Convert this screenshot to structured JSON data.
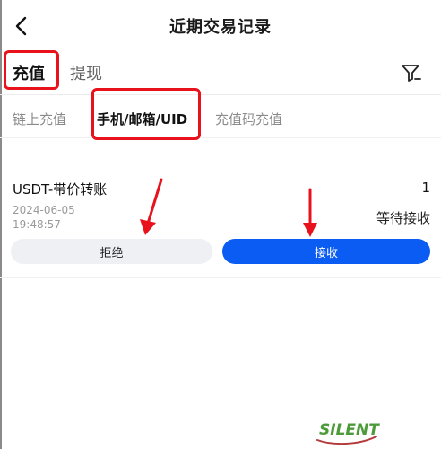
{
  "header": {
    "title": "近期交易记录"
  },
  "tabs": [
    {
      "label": "充值",
      "active": true
    },
    {
      "label": "提现",
      "active": false
    }
  ],
  "subtabs": [
    {
      "label": "链上充值"
    },
    {
      "label": "手机/邮箱/UID"
    },
    {
      "label": "充值码充值"
    }
  ],
  "record": {
    "title": "USDT-带价转账",
    "amount": "1",
    "date": "2024-06-05",
    "time": "19:48:57",
    "status": "等待接收",
    "reject_label": "拒绝",
    "accept_label": "接收"
  },
  "watermark": {
    "text": "SILENT"
  },
  "colors": {
    "accent": "#0a5cf2",
    "annotation": "#e8121c"
  }
}
